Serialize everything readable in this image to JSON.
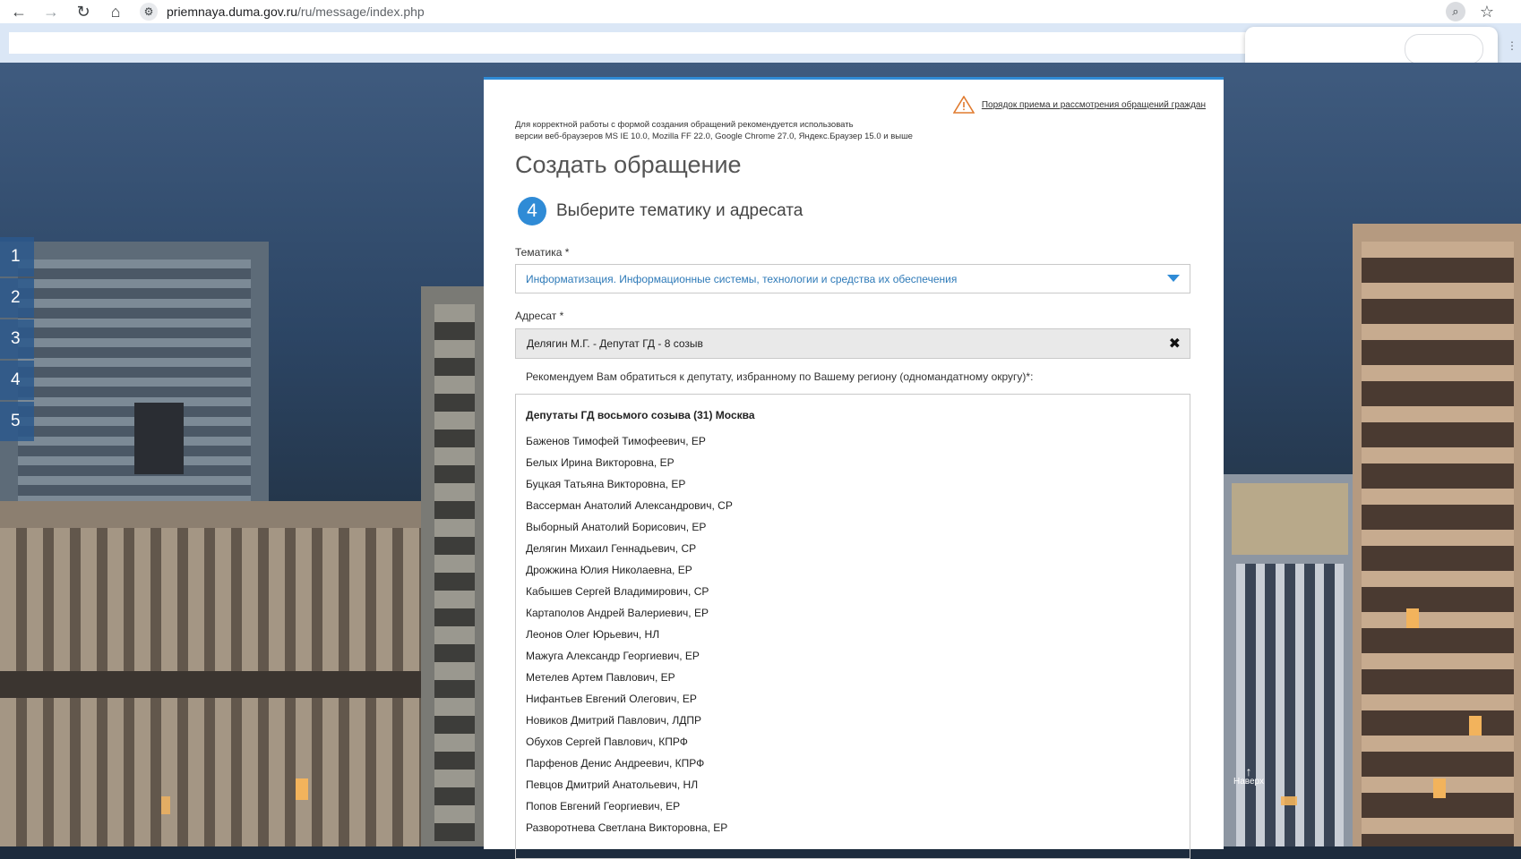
{
  "browser": {
    "url_host": "priemnaya.duma.gov.ru",
    "url_path": "/ru/message/index.php"
  },
  "side_steps": [
    "1",
    "2",
    "3",
    "4",
    "5"
  ],
  "form": {
    "notice_link": "Порядок приема и рассмотрения обращений граждан",
    "browser_note_line1": "Для корректной работы с формой создания обращений рекомендуется использовать",
    "browser_note_line2": "версии веб-браузеров MS IE 10.0, Mozilla FF 22.0, Google Chrome 27.0, Яндекс.Браузер 15.0 и выше",
    "title": "Создать обращение",
    "step_number": "4",
    "step_title": "Выберите тематику и адресата",
    "topic_label": "Тематика *",
    "topic_value": "Информатизация. Информационные системы, технологии и средства их обеспечения",
    "addressee_label": "Адресат *",
    "addressee_value": "Делягин М.Г. - Депутат ГД - 8 созыв",
    "recommend_text": "Рекомендуем Вам обратиться к депутату, избранному по Вашему региону (одномандатному округу)*:",
    "list_heading": "Депутаты ГД восьмого созыва (31) Москва",
    "deputies": [
      "Баженов Тимофей Тимофеевич, ЕР",
      "Белых Ирина Викторовна, ЕР",
      "Буцкая Татьяна Викторовна, ЕР",
      "Вассерман Анатолий Александрович, СР",
      "Выборный Анатолий Борисович, ЕР",
      "Делягин Михаил Геннадьевич, СР",
      "Дрожжина Юлия Николаевна, ЕР",
      "Кабышев Сергей Владимирович, СР",
      "Картаполов Андрей Валериевич, ЕР",
      "Леонов Олег Юрьевич, НЛ",
      "Мажуга Александр Георгиевич, ЕР",
      "Метелев Артем Павлович, ЕР",
      "Нифантьев Евгений Олегович, ЕР",
      "Новиков Дмитрий Павлович, ЛДПР",
      "Обухов Сергей Павлович, КПРФ",
      "Парфенов Денис Андреевич, КПРФ",
      "Певцов Дмитрий Анатольевич, НЛ",
      "Попов Евгений Георгиевич, ЕР",
      "Разворотнева Светлана Викторовна, ЕР"
    ]
  },
  "scroll_top_label": "Наверх",
  "colors": {
    "accent": "#2f8bd6",
    "topic_text": "#2e7ab8"
  }
}
